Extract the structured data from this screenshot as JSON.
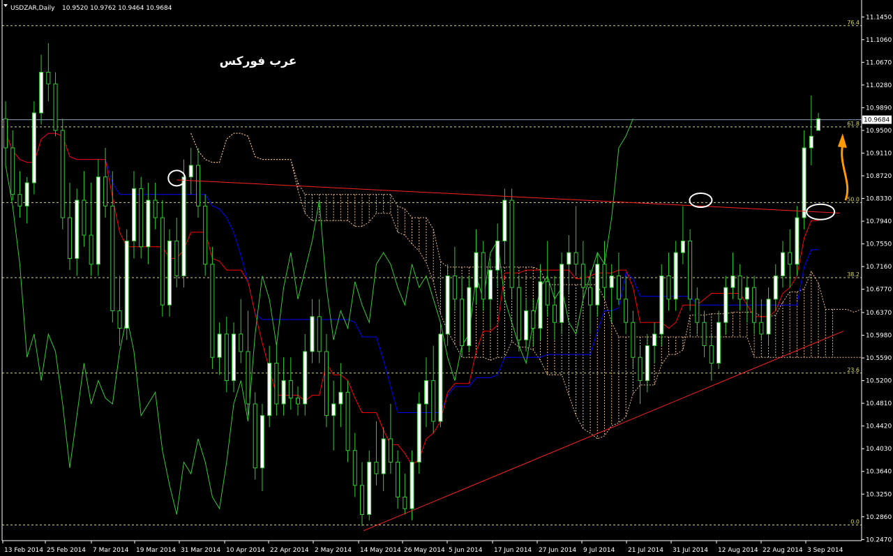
{
  "header": {
    "symbol": "USDZAR,Daily",
    "ohlc": "10.9520 10.9762 10.9464 10.9684"
  },
  "watermark": "عرب فوركس",
  "current_price_label": "10.9684",
  "colors": {
    "background": "#000000",
    "candle_bull": "#ffffff",
    "candle_outline": "#33cc33",
    "wick": "#33cc33",
    "kijun": "#0000ff",
    "tenkan": "#ff0000",
    "chikou": "#33cc33",
    "cloud": "#f0c090",
    "fib": "#d8d860",
    "trend": "#ff2020",
    "arrow": "#ff9900",
    "grid_text": "#ffffff"
  },
  "chart_data": {
    "type": "candlestick",
    "symbol": "USDZAR",
    "timeframe": "Daily",
    "ylim": [
      10.245,
      11.1645
    ],
    "y_ticks": [
      "11.1450",
      "11.1060",
      "11.0670",
      "11.0280",
      "10.9890",
      "10.9500",
      "10.9110",
      "10.8720",
      "10.8330",
      "10.7940",
      "10.7550",
      "10.7160",
      "10.6770",
      "10.6370",
      "10.5980",
      "10.5590",
      "10.5200",
      "10.4810",
      "10.4420",
      "10.4030",
      "10.3640",
      "10.3250",
      "10.2860",
      "10.2470"
    ],
    "x_ticks": [
      "13 Feb 2014",
      "25 Feb 2014",
      "7 Mar 2014",
      "19 Mar 2014",
      "31 Mar 2014",
      "10 Apr 2014",
      "22 Apr 2014",
      "2 May 2014",
      "14 May 2014",
      "26 May 2014",
      "5 Jun 2014",
      "17 Jun 2014",
      "27 Jun 2014",
      "9 Jul 2014",
      "21 Jul 2014",
      "31 Jul 2014",
      "12 Aug 2014",
      "22 Aug 2014",
      "3 Sep 2014"
    ],
    "fibonacci": [
      {
        "label": "76.4",
        "value": 11.13
      },
      {
        "label": "61.8",
        "value": 10.956
      },
      {
        "label": "50.0",
        "value": 10.826
      },
      {
        "label": "38.2",
        "value": 10.697
      },
      {
        "label": "23.6",
        "value": 10.533
      },
      {
        "label": "0.0",
        "value": 10.272
      }
    ],
    "current_price": 10.9684,
    "candles": [
      [
        10.97,
        11.0,
        10.89,
        10.92
      ],
      [
        10.92,
        10.95,
        10.83,
        10.84
      ],
      [
        10.84,
        10.88,
        10.8,
        10.82
      ],
      [
        10.82,
        10.87,
        10.79,
        10.86
      ],
      [
        10.86,
        11.0,
        10.84,
        10.98
      ],
      [
        10.98,
        11.08,
        10.96,
        11.05
      ],
      [
        11.05,
        11.1,
        11.0,
        11.03
      ],
      [
        11.03,
        11.05,
        10.94,
        10.95
      ],
      [
        10.95,
        10.97,
        10.78,
        10.8
      ],
      [
        10.8,
        10.86,
        10.71,
        10.73
      ],
      [
        10.73,
        10.85,
        10.7,
        10.83
      ],
      [
        10.83,
        10.88,
        10.75,
        10.77
      ],
      [
        10.77,
        10.86,
        10.7,
        10.72
      ],
      [
        10.72,
        10.9,
        10.7,
        10.87
      ],
      [
        10.87,
        10.92,
        10.8,
        10.82
      ],
      [
        10.82,
        10.88,
        10.62,
        10.64
      ],
      [
        10.64,
        10.7,
        10.58,
        10.61
      ],
      [
        10.61,
        10.78,
        10.59,
        10.76
      ],
      [
        10.76,
        10.88,
        10.73,
        10.85
      ],
      [
        10.85,
        10.87,
        10.73,
        10.75
      ],
      [
        10.75,
        10.86,
        10.72,
        10.83
      ],
      [
        10.83,
        10.86,
        10.78,
        10.8
      ],
      [
        10.8,
        10.83,
        10.63,
        10.65
      ],
      [
        10.65,
        10.78,
        10.63,
        10.76
      ],
      [
        10.76,
        10.8,
        10.68,
        10.7
      ],
      [
        10.7,
        10.9,
        10.68,
        10.87
      ],
      [
        10.87,
        10.92,
        10.84,
        10.89
      ],
      [
        10.89,
        10.92,
        10.8,
        10.82
      ],
      [
        10.82,
        10.84,
        10.7,
        10.72
      ],
      [
        10.72,
        10.75,
        10.54,
        10.56
      ],
      [
        10.56,
        10.62,
        10.53,
        10.6
      ],
      [
        10.6,
        10.63,
        10.5,
        10.52
      ],
      [
        10.52,
        10.62,
        10.5,
        10.6
      ],
      [
        10.6,
        10.66,
        10.55,
        10.57
      ],
      [
        10.57,
        10.64,
        10.46,
        10.48
      ],
      [
        10.48,
        10.5,
        10.35,
        10.37
      ],
      [
        10.37,
        10.48,
        10.33,
        10.46
      ],
      [
        10.46,
        10.58,
        10.44,
        10.55
      ],
      [
        10.55,
        10.58,
        10.46,
        10.48
      ],
      [
        10.48,
        10.56,
        10.46,
        10.52
      ],
      [
        10.52,
        10.56,
        10.47,
        10.49
      ],
      [
        10.49,
        10.51,
        10.46,
        10.48
      ],
      [
        10.48,
        10.6,
        10.46,
        10.57
      ],
      [
        10.57,
        10.66,
        10.55,
        10.63
      ],
      [
        10.63,
        10.66,
        10.55,
        10.57
      ],
      [
        10.57,
        10.6,
        10.44,
        10.46
      ],
      [
        10.46,
        10.52,
        10.4,
        10.48
      ],
      [
        10.48,
        10.55,
        10.44,
        10.5
      ],
      [
        10.5,
        10.52,
        10.38,
        10.4
      ],
      [
        10.4,
        10.43,
        10.32,
        10.34
      ],
      [
        10.34,
        10.38,
        10.27,
        10.29
      ],
      [
        10.29,
        10.4,
        10.28,
        10.38
      ],
      [
        10.38,
        10.45,
        10.34,
        10.36
      ],
      [
        10.36,
        10.44,
        10.33,
        10.42
      ],
      [
        10.42,
        10.48,
        10.36,
        10.38
      ],
      [
        10.38,
        10.4,
        10.3,
        10.32
      ],
      [
        10.32,
        10.36,
        10.29,
        10.3
      ],
      [
        10.3,
        10.4,
        10.28,
        10.38
      ],
      [
        10.38,
        10.5,
        10.36,
        10.48
      ],
      [
        10.48,
        10.56,
        10.44,
        10.52
      ],
      [
        10.52,
        10.58,
        10.43,
        10.45
      ],
      [
        10.45,
        10.62,
        10.44,
        10.6
      ],
      [
        10.6,
        10.72,
        10.58,
        10.7
      ],
      [
        10.7,
        10.75,
        10.64,
        10.66
      ],
      [
        10.66,
        10.7,
        10.56,
        10.58
      ],
      [
        10.58,
        10.7,
        10.57,
        10.68
      ],
      [
        10.68,
        10.78,
        10.65,
        10.74
      ],
      [
        10.74,
        10.76,
        10.64,
        10.66
      ],
      [
        10.66,
        10.73,
        10.61,
        10.71
      ],
      [
        10.71,
        10.79,
        10.68,
        10.76
      ],
      [
        10.76,
        10.85,
        10.72,
        10.83
      ],
      [
        10.83,
        10.85,
        10.66,
        10.68
      ],
      [
        10.68,
        10.7,
        10.57,
        10.59
      ],
      [
        10.59,
        10.66,
        10.57,
        10.64
      ],
      [
        10.64,
        10.66,
        10.58,
        10.61
      ],
      [
        10.61,
        10.72,
        10.59,
        10.69
      ],
      [
        10.69,
        10.76,
        10.63,
        10.65
      ],
      [
        10.65,
        10.7,
        10.59,
        10.62
      ],
      [
        10.62,
        10.74,
        10.6,
        10.72
      ],
      [
        10.72,
        10.77,
        10.67,
        10.74
      ],
      [
        10.74,
        10.82,
        10.7,
        10.72
      ],
      [
        10.72,
        10.76,
        10.66,
        10.68
      ],
      [
        10.68,
        10.71,
        10.6,
        10.65
      ],
      [
        10.65,
        10.74,
        10.63,
        10.72
      ],
      [
        10.72,
        10.76,
        10.66,
        10.68
      ],
      [
        10.68,
        10.72,
        10.62,
        10.7
      ],
      [
        10.7,
        10.74,
        10.65,
        10.66
      ],
      [
        10.66,
        10.7,
        10.6,
        10.62
      ],
      [
        10.62,
        10.64,
        10.54,
        10.56
      ],
      [
        10.56,
        10.58,
        10.48,
        10.52
      ],
      [
        10.52,
        10.6,
        10.5,
        10.58
      ],
      [
        10.58,
        10.62,
        10.55,
        10.6
      ],
      [
        10.6,
        10.72,
        10.58,
        10.7
      ],
      [
        10.7,
        10.74,
        10.64,
        10.66
      ],
      [
        10.66,
        10.76,
        10.64,
        10.74
      ],
      [
        10.74,
        10.82,
        10.72,
        10.76
      ],
      [
        10.76,
        10.78,
        10.64,
        10.66
      ],
      [
        10.66,
        10.68,
        10.6,
        10.62
      ],
      [
        10.62,
        10.64,
        10.56,
        10.58
      ],
      [
        10.58,
        10.6,
        10.52,
        10.55
      ],
      [
        10.55,
        10.64,
        10.54,
        10.62
      ],
      [
        10.62,
        10.7,
        10.6,
        10.68
      ],
      [
        10.68,
        10.74,
        10.66,
        10.7
      ],
      [
        10.7,
        10.72,
        10.64,
        10.66
      ],
      [
        10.66,
        10.7,
        10.62,
        10.68
      ],
      [
        10.68,
        10.7,
        10.6,
        10.62
      ],
      [
        10.62,
        10.66,
        10.59,
        10.6
      ],
      [
        10.6,
        10.68,
        10.58,
        10.66
      ],
      [
        10.66,
        10.72,
        10.64,
        10.7
      ],
      [
        10.7,
        10.76,
        10.68,
        10.74
      ],
      [
        10.74,
        10.78,
        10.68,
        10.72
      ],
      [
        10.72,
        10.82,
        10.7,
        10.8
      ],
      [
        10.8,
        10.95,
        10.78,
        10.92
      ],
      [
        10.92,
        11.01,
        10.89,
        10.94
      ],
      [
        10.95,
        10.98,
        10.95,
        10.97
      ]
    ],
    "trendlines": [
      {
        "name": "resistance",
        "from": [
          24,
          10.865
        ],
        "to": [
          117,
          10.808
        ]
      },
      {
        "name": "support",
        "from": [
          50.2,
          10.262
        ],
        "to": [
          117.5,
          10.605
        ]
      }
    ]
  }
}
